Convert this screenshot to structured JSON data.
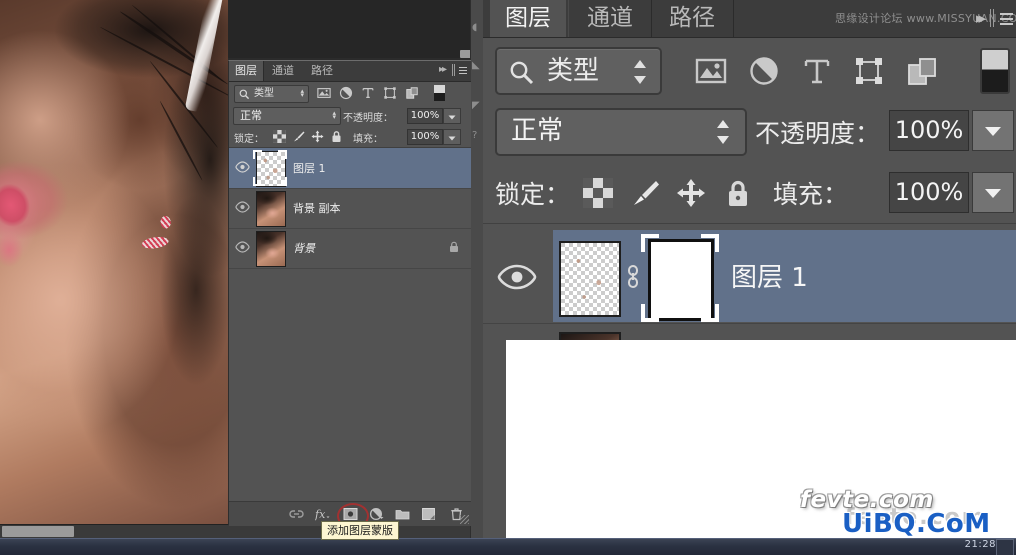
{
  "app": {
    "name": "Adobe Photoshop",
    "locale": "zh-CN"
  },
  "document_window": {
    "canvas_background": "#2b2b2b",
    "photo_description": "close-up portrait: skin, dark hair, white strap, pink striped earring"
  },
  "taskbar": {
    "clock": "21:28"
  },
  "small_layers_panel": {
    "tabs": [
      {
        "label": "图层",
        "active": true
      },
      {
        "label": "通道",
        "active": false
      },
      {
        "label": "路径",
        "active": false
      }
    ],
    "filter": {
      "icon": "search-icon",
      "value": "类型",
      "type_icons": [
        "pixel-layer-icon",
        "adjustment-layer-icon",
        "type-layer-icon",
        "shape-layer-icon",
        "smart-object-icon"
      ],
      "toggle_swatch": "filter-toggle-swatch"
    },
    "blend": {
      "mode": "正常",
      "opacity_label": "不透明度：",
      "opacity_value": "100%"
    },
    "lock": {
      "label": "锁定：",
      "icons": [
        "lock-transparency-icon",
        "lock-image-icon",
        "lock-position-icon",
        "lock-all-icon"
      ],
      "fill_label": "填充：",
      "fill_value": "100%"
    },
    "layers": [
      {
        "name": "图层 1",
        "selected": true,
        "visible": true,
        "locked": false,
        "italic": false,
        "thumb": "checker"
      },
      {
        "name": "背景 副本",
        "selected": false,
        "visible": true,
        "locked": false,
        "italic": false,
        "thumb": "photo"
      },
      {
        "name": "背景",
        "selected": false,
        "visible": true,
        "locked": true,
        "italic": true,
        "thumb": "photo"
      }
    ],
    "bottom_buttons": [
      {
        "name": "link-layers-icon",
        "label": "链接图层"
      },
      {
        "name": "layer-style-icon",
        "label": "fx"
      },
      {
        "name": "add-layer-mask-icon",
        "label": "添加图层蒙版",
        "highlighted": true
      },
      {
        "name": "new-adjustment-layer-icon",
        "label": "创建新的填充或调整图层"
      },
      {
        "name": "new-group-icon",
        "label": "创建新组"
      },
      {
        "name": "new-layer-icon",
        "label": "创建新图层"
      },
      {
        "name": "delete-layer-icon",
        "label": "删除图层"
      }
    ]
  },
  "tooltip": {
    "text": "添加图层蒙版"
  },
  "magnified_layers_panel": {
    "tabs": [
      {
        "label": "图层",
        "active": true
      },
      {
        "label": "通道",
        "active": false
      },
      {
        "label": "路径",
        "active": false
      }
    ],
    "watermark": "思缘设计论坛 www.MISSYUAN.COM",
    "filter": {
      "icon": "search-icon",
      "value": "类型",
      "type_icons": [
        "pixel-layer-icon",
        "adjustment-layer-icon",
        "type-layer-icon",
        "shape-layer-icon",
        "smart-object-icon"
      ]
    },
    "blend": {
      "mode": "正常",
      "opacity_label": "不透明度：",
      "opacity_value": "100%"
    },
    "lock": {
      "label": "锁定：",
      "fill_label": "填充：",
      "fill_value": "100%"
    },
    "selected_layer": {
      "name": "图层 1",
      "visible": true,
      "has_mask": true,
      "mask_color": "#ffffff",
      "linked": true
    }
  },
  "watermarks": {
    "fevte": "fevte.com",
    "uibq": "UiBQ.CoM"
  },
  "colors": {
    "panel_bg": "#535353",
    "panel_dark": "#3c3c3c",
    "selection_blue": "#61718a",
    "tooltip_bg": "#fdf6d2",
    "highlight_ring": "#b02d2d"
  }
}
